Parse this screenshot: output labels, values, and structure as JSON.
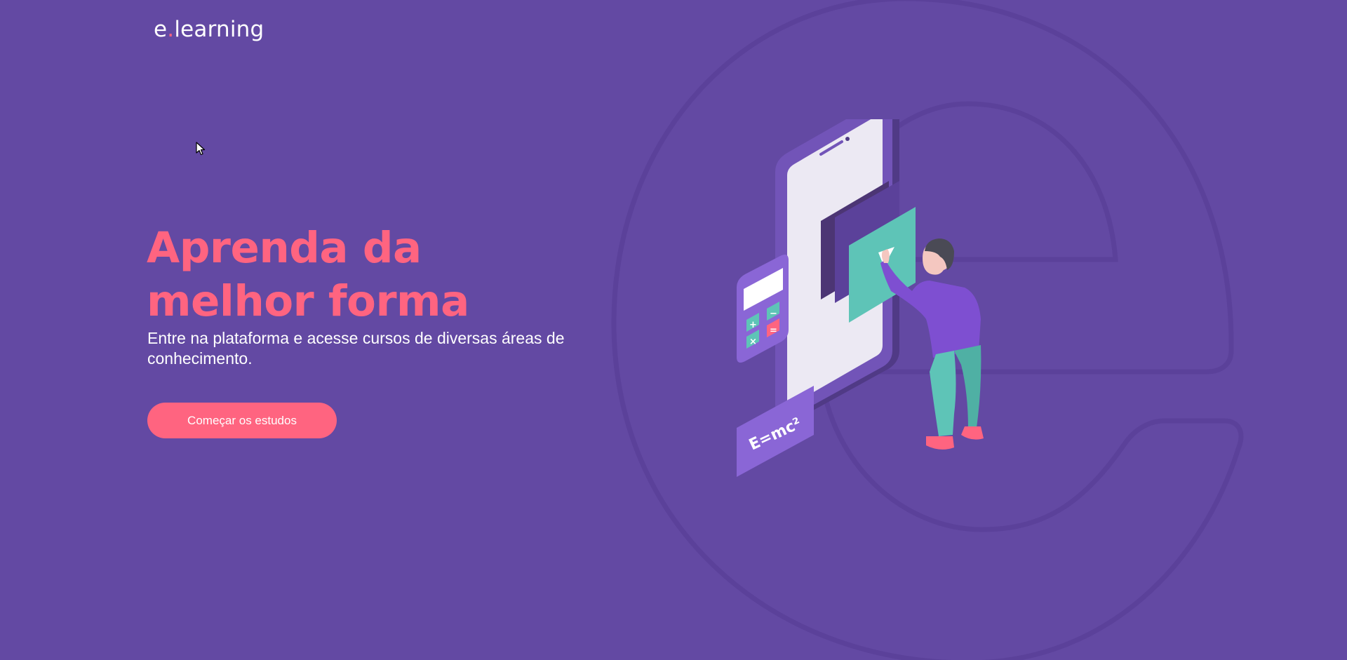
{
  "header": {
    "logo_prefix": "e",
    "logo_dot": ".",
    "logo_suffix": "learning"
  },
  "hero": {
    "title": "Aprenda da melhor forma",
    "subtitle": "Entre na plataforma e acesse cursos de diversas áreas de conhecimento.",
    "cta_label": "Começar os estudos"
  },
  "illustration": {
    "formula": "E=mc²",
    "calculator_keys": [
      "+",
      "−",
      "×",
      "="
    ],
    "icons": [
      "background-e-letter-icon",
      "smartphone-icon",
      "calculator-icon",
      "play-icon",
      "formula-card-icon",
      "person-icon",
      "mouse-cursor-icon"
    ]
  },
  "colors": {
    "background": "#6349a3",
    "accent": "#ff6480",
    "teal": "#5ec4b7",
    "text": "#ffffff"
  }
}
